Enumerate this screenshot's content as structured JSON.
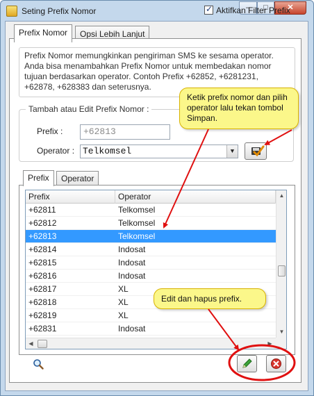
{
  "window": {
    "title": "Seting Prefix Nomor",
    "close_label": "✕",
    "maximize_label": "□",
    "minimize_label": "–"
  },
  "tabs": [
    {
      "label": "Prefix Nomor",
      "active": true
    },
    {
      "label": "Opsi Lebih Lanjut",
      "active": false
    }
  ],
  "filter_checkbox": {
    "label": "Aktifkan Filter Prefix",
    "checked": true
  },
  "info_text": "Prefix Nomor memungkinkan pengiriman SMS ke sesama operator. Anda bisa menambahkan Prefix Nomor untuk membedakan nomor tujuan berdasarkan operator. Contoh Prefix +62852, +6281231, +62878, +628383 dan seterusnya.",
  "edit_group": {
    "title": "Tambah atau Edit Prefix Nomor :",
    "prefix_label": "Prefix :",
    "prefix_value": "+62813",
    "operator_label": "Operator :",
    "operator_value": "Telkomsel"
  },
  "sub_tabs": [
    {
      "label": "Prefix",
      "active": true
    },
    {
      "label": "Operator",
      "active": false
    }
  ],
  "table": {
    "columns": [
      "Prefix",
      "Operator"
    ],
    "rows": [
      {
        "prefix": "+62811",
        "operator": "Telkomsel",
        "selected": false
      },
      {
        "prefix": "+62812",
        "operator": "Telkomsel",
        "selected": false
      },
      {
        "prefix": "+62813",
        "operator": "Telkomsel",
        "selected": true
      },
      {
        "prefix": "+62814",
        "operator": "Indosat",
        "selected": false
      },
      {
        "prefix": "+62815",
        "operator": "Indosat",
        "selected": false
      },
      {
        "prefix": "+62816",
        "operator": "Indosat",
        "selected": false
      },
      {
        "prefix": "+62817",
        "operator": "XL",
        "selected": false
      },
      {
        "prefix": "+62818",
        "operator": "XL",
        "selected": false
      },
      {
        "prefix": "+62819",
        "operator": "XL",
        "selected": false
      },
      {
        "prefix": "+62831",
        "operator": "Indosat",
        "selected": false
      }
    ]
  },
  "callouts": {
    "save_hint": "Ketik prefix nomor dan pilih operator lalu tekan tombol Simpan.",
    "edit_hint": "Edit dan hapus prefix."
  },
  "colors": {
    "selection": "#3399ff",
    "callout_fill": "#fbf78a",
    "annotation_red": "#e01010"
  },
  "icons": {
    "app": "app-icon",
    "save": "save-icon",
    "search": "search-icon",
    "edit": "pencil-icon",
    "delete": "delete-icon",
    "dropdown": "chevron-down-icon"
  }
}
